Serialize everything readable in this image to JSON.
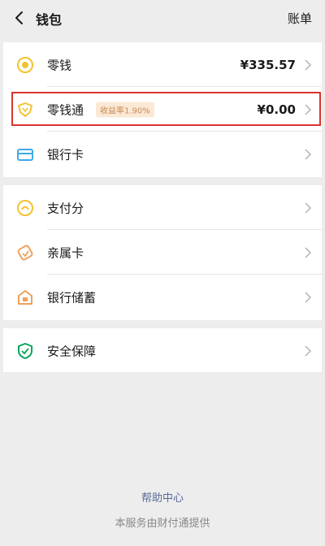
{
  "header": {
    "title": "钱包",
    "bill_label": "账单"
  },
  "groups": [
    {
      "items": [
        {
          "label": "零钱",
          "value": "¥335.57",
          "icon": "coin-icon"
        },
        {
          "label": "零钱通",
          "badge": "收益率1.90%",
          "value": "¥0.00",
          "icon": "diamond-icon"
        },
        {
          "label": "银行卡",
          "icon": "card-icon"
        }
      ]
    },
    {
      "items": [
        {
          "label": "支付分",
          "icon": "score-icon"
        },
        {
          "label": "亲属卡",
          "icon": "family-card-icon"
        },
        {
          "label": "银行储蓄",
          "icon": "savings-icon"
        }
      ]
    },
    {
      "items": [
        {
          "label": "安全保障",
          "icon": "shield-icon"
        }
      ]
    }
  ],
  "footer": {
    "help": "帮助中心",
    "provider": "本服务由财付通提供"
  },
  "colors": {
    "background": "#ededed",
    "badge_bg": "#fbe9d6",
    "badge_text": "#c98a52",
    "highlight": "#d9352c",
    "link": "#576b95",
    "gold": "#f2c230",
    "blue": "#3fa9e8",
    "green": "#07a55a"
  }
}
